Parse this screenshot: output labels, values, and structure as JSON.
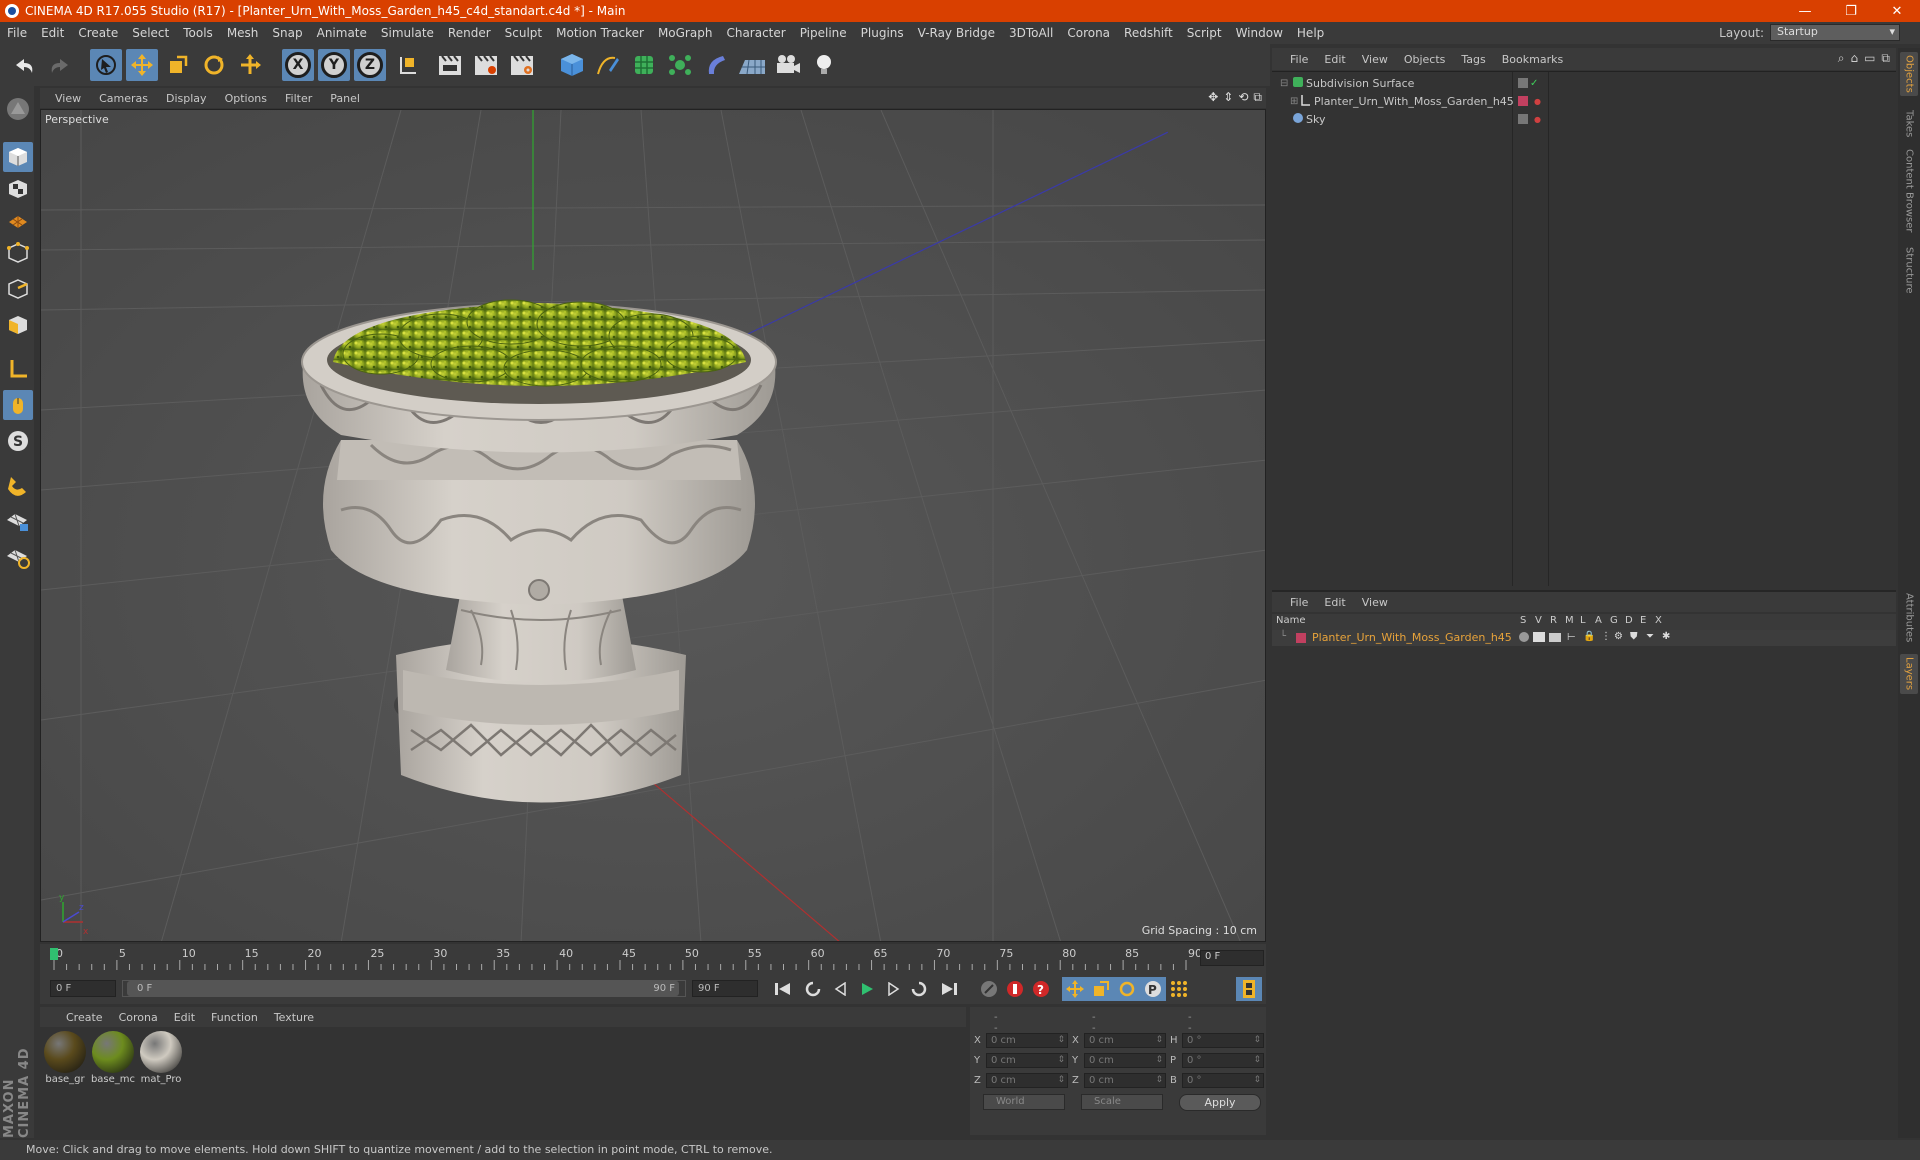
{
  "titlebar": {
    "title": "CINEMA 4D R17.055 Studio (R17) - [Planter_Urn_With_Moss_Garden_h45_c4d_standart.c4d *] - Main",
    "minimize": "—",
    "restore": "❐",
    "close": "✕"
  },
  "menubar": [
    "File",
    "Edit",
    "Create",
    "Select",
    "Tools",
    "Mesh",
    "Snap",
    "Animate",
    "Simulate",
    "Render",
    "Sculpt",
    "Motion Tracker",
    "MoGraph",
    "Character",
    "Pipeline",
    "Plugins",
    "V-Ray Bridge",
    "3DToAll",
    "Corona",
    "Redshift",
    "Script",
    "Window",
    "Help"
  ],
  "layout": {
    "label": "Layout:",
    "value": "Startup"
  },
  "toolbar": {
    "axis_x": "X",
    "axis_y": "Y",
    "axis_z": "Z"
  },
  "viewport": {
    "menu": [
      "View",
      "Cameras",
      "Display",
      "Options",
      "Filter",
      "Panel"
    ],
    "label": "Perspective",
    "grid_spacing": "Grid Spacing : 10 cm"
  },
  "timeline": {
    "ticks": [
      "0",
      "5",
      "10",
      "15",
      "20",
      "25",
      "30",
      "35",
      "40",
      "45",
      "50",
      "55",
      "60",
      "65",
      "70",
      "75",
      "80",
      "85",
      "90"
    ],
    "current_frame": "0 F",
    "start_field": "0 F",
    "range_start": "0 F",
    "range_end": "90 F",
    "end_field": "90 F"
  },
  "materials": {
    "menu": [
      "Create",
      "Corona",
      "Edit",
      "Function",
      "Texture"
    ],
    "items": [
      {
        "label": "base_gr",
        "color": "#5a4a1c"
      },
      {
        "label": "base_mc",
        "color": "#6d8c1e"
      },
      {
        "label": "mat_Pro",
        "color": "#cfcac0"
      }
    ]
  },
  "coordinates": {
    "header": [
      "--",
      "--",
      "--"
    ],
    "rows": [
      {
        "a": "X",
        "av": "0 cm",
        "b": "X",
        "bv": "0 cm",
        "c": "H",
        "cv": "0 °"
      },
      {
        "a": "Y",
        "av": "0 cm",
        "b": "Y",
        "bv": "0 cm",
        "c": "P",
        "cv": "0 °"
      },
      {
        "a": "Z",
        "av": "0 cm",
        "b": "Z",
        "bv": "0 cm",
        "c": "B",
        "cv": "0 °"
      }
    ],
    "world": "World",
    "scale": "Scale",
    "apply": "Apply"
  },
  "status": "Move: Click and drag to move elements. Hold down SHIFT to quantize movement / add to the selection in point mode, CTRL to remove.",
  "objects": {
    "menu": [
      "File",
      "Edit",
      "View",
      "Objects",
      "Tags",
      "Bookmarks"
    ],
    "rows": [
      {
        "name": "Subdivision Surface"
      },
      {
        "name": "Planter_Urn_With_Moss_Garden_h45"
      },
      {
        "name": "Sky"
      }
    ]
  },
  "layers": {
    "menu": [
      "File",
      "Edit",
      "View"
    ],
    "header_name": "Name",
    "columns": [
      "S",
      "V",
      "R",
      "M",
      "L",
      "A",
      "G",
      "D",
      "E",
      "X"
    ],
    "row_name": "Planter_Urn_With_Moss_Garden_h45",
    "row_color": "#c24060"
  },
  "side_tabs": [
    "Objects",
    "Takes",
    "Content Browser",
    "Structure",
    "Attributes",
    "Layers"
  ],
  "maxon": "MAXON CINEMA 4D",
  "colors": {
    "accent": "#5b87b5",
    "title": "#d94000",
    "highlight": "#e8a33a"
  }
}
